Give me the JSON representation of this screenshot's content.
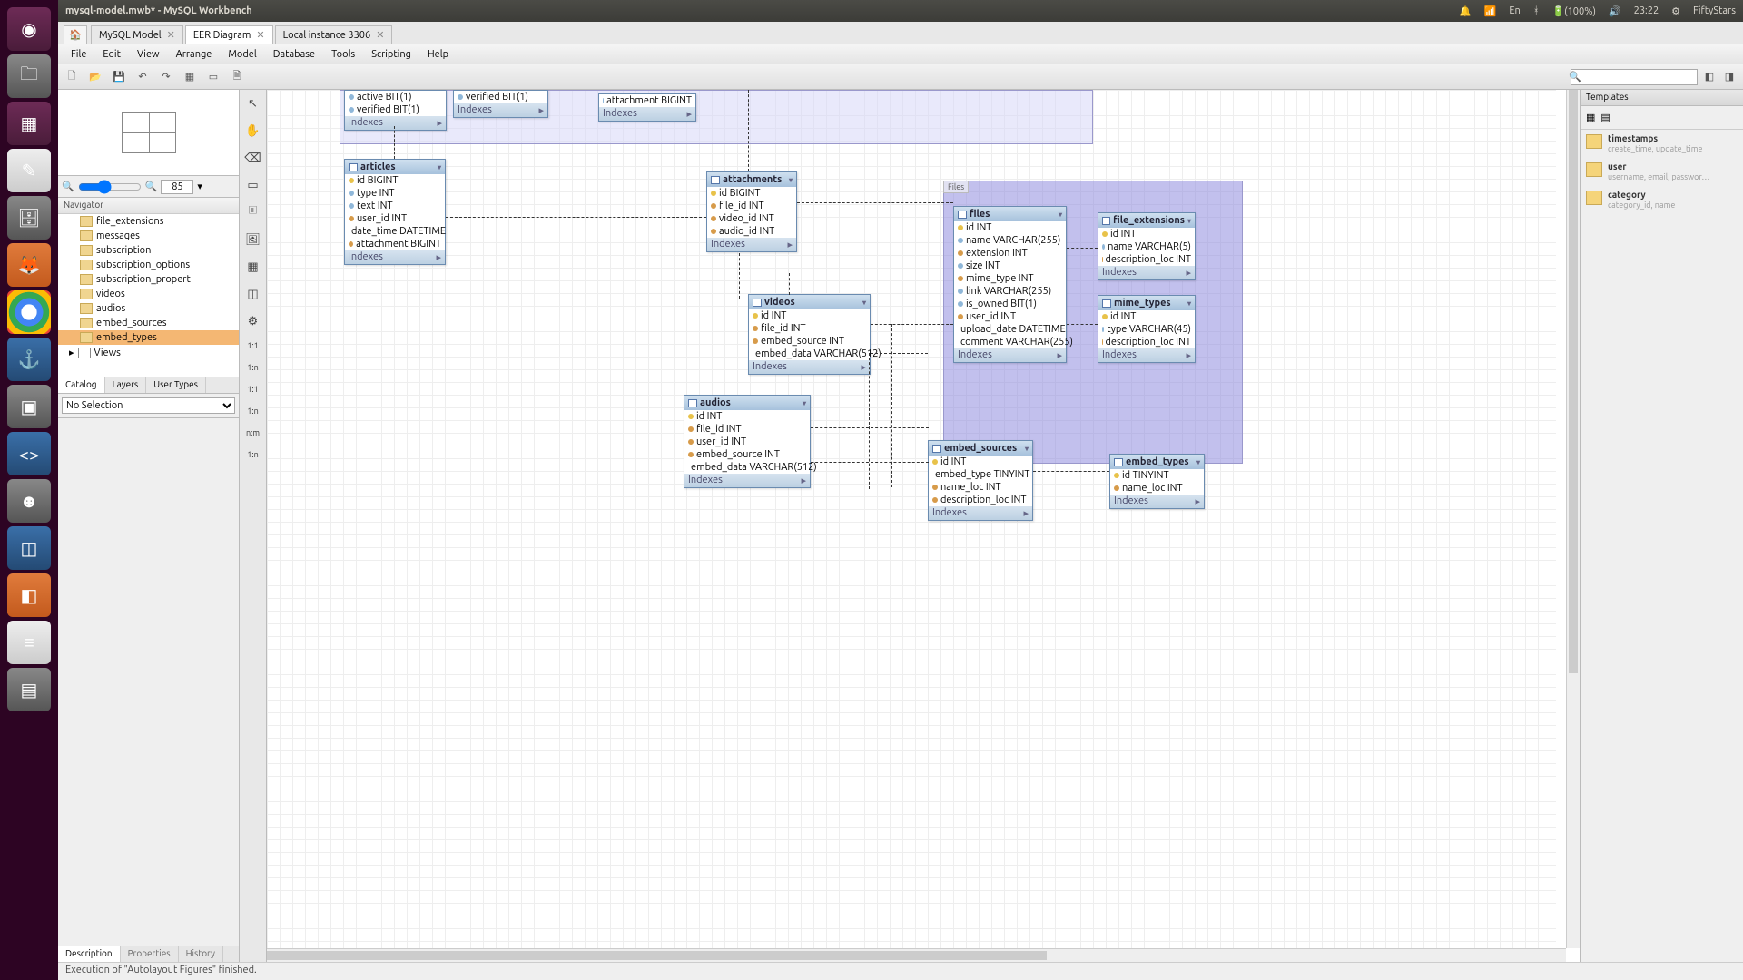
{
  "titlebar": {
    "title": "mysql-model.mwb* - MySQL Workbench",
    "battery": "(100%)",
    "time": "23:22",
    "user": "FiftyStars",
    "lang": "En"
  },
  "tabs": {
    "t0": "MySQL Model",
    "t1": "EER Diagram",
    "t2": "Local instance 3306"
  },
  "menu": {
    "file": "File",
    "edit": "Edit",
    "view": "View",
    "arrange": "Arrange",
    "model": "Model",
    "database": "Database",
    "tools": "Tools",
    "scripting": "Scripting",
    "help": "Help"
  },
  "zoom": "85",
  "navigator": "Navigator",
  "tree": [
    "file_extensions",
    "messages",
    "subscription",
    "subscription_options",
    "subscription_propert",
    "videos",
    "audios",
    "embed_sources",
    "embed_types"
  ],
  "tree_views": "Views",
  "bottabs": {
    "catalog": "Catalog",
    "layers": "Layers",
    "usertypes": "User Types"
  },
  "sel": "No Selection",
  "bottabs2": {
    "desc": "Description",
    "props": "Properties",
    "hist": "History"
  },
  "templates": {
    "title": "Templates",
    "t1": {
      "n": "timestamps",
      "d": "create_time, update_time"
    },
    "t2": {
      "n": "user",
      "d": "username, email, passwor…"
    },
    "t3": {
      "n": "category",
      "d": "category_id, name"
    }
  },
  "status": "Execution of \"Autolayout Figures\" finished.",
  "region_files": "Files",
  "tables": {
    "partial1": {
      "cols": [
        "active BIT(1)",
        "verified BIT(1)"
      ],
      "idx": "Indexes"
    },
    "partial2": {
      "cols": [
        "verified BIT(1)"
      ],
      "idx": "Indexes"
    },
    "partial3": {
      "cols": [
        "attachment BIGINT"
      ],
      "idx": "Indexes"
    },
    "articles": {
      "name": "articles",
      "cols": [
        "id BIGINT",
        "type INT",
        "text INT",
        "user_id INT",
        "date_time DATETIME",
        "attachment BIGINT"
      ],
      "idx": "Indexes"
    },
    "attachments": {
      "name": "attachments",
      "cols": [
        "id BIGINT",
        "file_id INT",
        "video_id INT",
        "audio_id INT"
      ],
      "idx": "Indexes"
    },
    "videos": {
      "name": "videos",
      "cols": [
        "id INT",
        "file_id INT",
        "embed_source INT",
        "embed_data VARCHAR(512)"
      ],
      "idx": "Indexes"
    },
    "audios": {
      "name": "audios",
      "cols": [
        "id INT",
        "file_id INT",
        "user_id INT",
        "embed_source INT",
        "embed_data VARCHAR(512)"
      ],
      "idx": "Indexes"
    },
    "files": {
      "name": "files",
      "cols": [
        "id INT",
        "name VARCHAR(255)",
        "extension INT",
        "size INT",
        "mime_type INT",
        "link VARCHAR(255)",
        "is_owned BIT(1)",
        "user_id INT",
        "upload_date DATETIME",
        "comment VARCHAR(255)"
      ],
      "idx": "Indexes"
    },
    "file_extensions": {
      "name": "file_extensions",
      "cols": [
        "id INT",
        "name VARCHAR(5)",
        "description_loc INT"
      ],
      "idx": "Indexes"
    },
    "mime_types": {
      "name": "mime_types",
      "cols": [
        "id INT",
        "type VARCHAR(45)",
        "description_loc INT"
      ],
      "idx": "Indexes"
    },
    "embed_sources": {
      "name": "embed_sources",
      "cols": [
        "id INT",
        "embed_type TINYINT",
        "name_loc INT",
        "description_loc INT"
      ],
      "idx": "Indexes"
    },
    "embed_types": {
      "name": "embed_types",
      "cols": [
        "id TINYINT",
        "name_loc INT"
      ],
      "idx": "Indexes"
    }
  }
}
